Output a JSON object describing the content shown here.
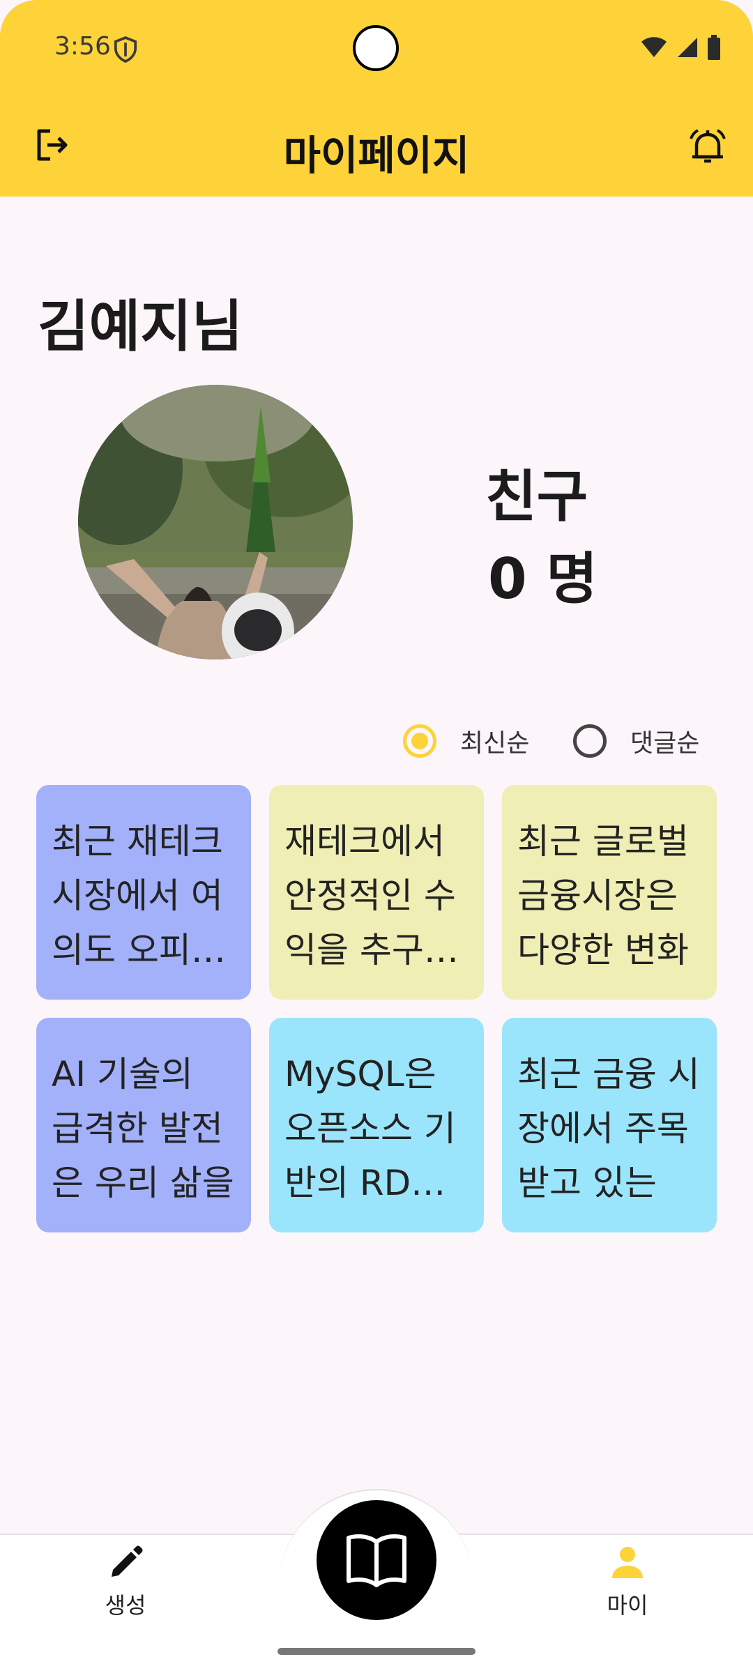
{
  "status_bar": {
    "time": "3:56"
  },
  "header": {
    "title": "마이페이지"
  },
  "profile": {
    "username": "김예지님",
    "friends_label": "친구",
    "friends_count": "0 명"
  },
  "sort": {
    "options": [
      {
        "label": "최신순",
        "selected": true
      },
      {
        "label": "댓글순",
        "selected": false
      }
    ]
  },
  "posts": [
    {
      "text": "최근 재테크 시장에서 여의도 오피스텔",
      "color": "#A3B1FA"
    },
    {
      "text": "재테크에서 안정적인 수익을 추구하는",
      "color": "#EFEEB4"
    },
    {
      "text": "최근 글로벌 금융시장은 다양한 변화",
      "color": "#EFEEB4"
    },
    {
      "text": "AI 기술의 급격한 발전은 우리 삶을",
      "color": "#A3B1FA"
    },
    {
      "text": "MySQL은 오픈소스 기반의 RDBMS",
      "color": "#9BE5FC"
    },
    {
      "text": "최근 금융 시장에서 주목받고 있는",
      "color": "#9BE5FC"
    }
  ],
  "bottom_nav": {
    "create_label": "생성",
    "my_label": "마이"
  },
  "colors": {
    "accent": "#FDD339",
    "background": "#FCF6FB"
  }
}
